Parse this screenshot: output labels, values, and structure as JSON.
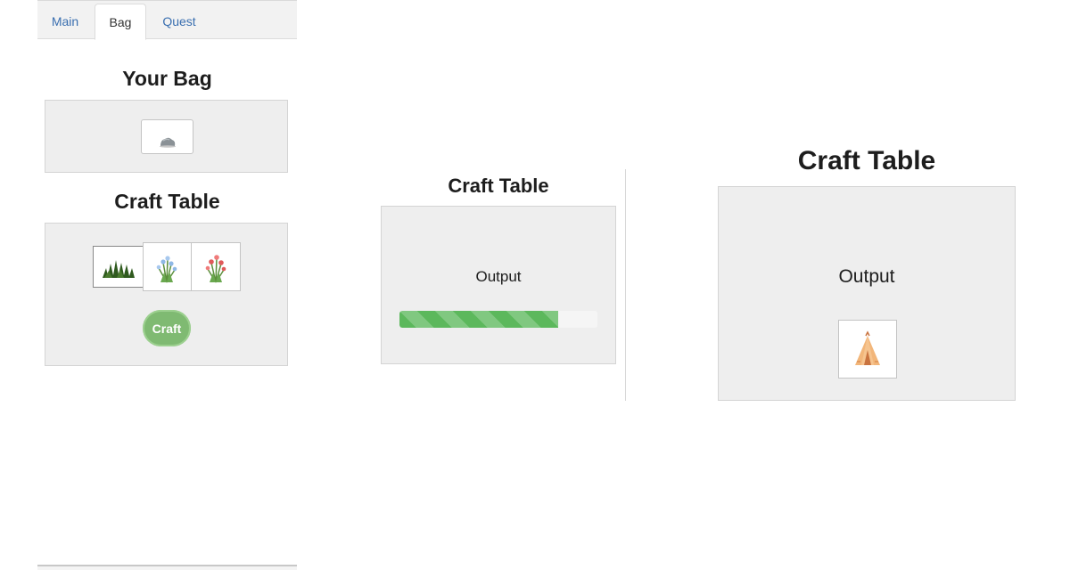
{
  "tabs": [
    {
      "label": "Main",
      "active": false
    },
    {
      "label": "Bag",
      "active": true
    },
    {
      "label": "Quest",
      "active": false
    }
  ],
  "bag": {
    "title": "Your Bag",
    "items": [
      "rock-icon"
    ]
  },
  "craft_table_left": {
    "title": "Craft Table",
    "slots": [
      "grass-icon",
      "blue-flower-icon",
      "red-flower-icon"
    ],
    "button_label": "Craft"
  },
  "craft_table_middle": {
    "title": "Craft Table",
    "output_label": "Output",
    "progress": 0.8
  },
  "craft_table_right": {
    "title": "Craft Table",
    "output_label": "Output",
    "output_item": "tent-icon"
  },
  "colors": {
    "accent_green": "#5cb85c",
    "button_green": "#7fba72",
    "tab_link": "#3a6fb0",
    "panel_bg": "#eeeeee"
  }
}
